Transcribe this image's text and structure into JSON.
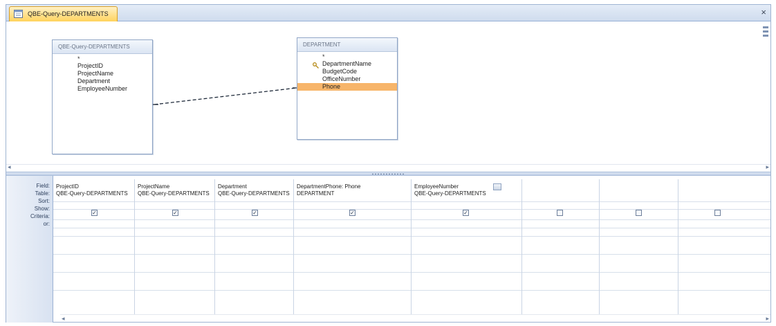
{
  "window": {
    "tab_title": "QBE-Query-DEPARTMENTS"
  },
  "tables": {
    "left": {
      "title": "QBE-Query-DEPARTMENTS",
      "star": "*",
      "fields": [
        "ProjectID",
        "ProjectName",
        "Department",
        "EmployeeNumber"
      ]
    },
    "right": {
      "title": "DEPARTMENT",
      "star": "*",
      "fields": [
        "DepartmentName",
        "BudgetCode",
        "OfficeNumber",
        "Phone"
      ],
      "selected_field": "Phone"
    }
  },
  "grid": {
    "row_labels": [
      "Field:",
      "Table:",
      "Sort:",
      "Show:",
      "Criteria:",
      "or:"
    ],
    "columns": [
      {
        "field": "ProjectID",
        "table": "QBE-Query-DEPARTMENTS",
        "show": true
      },
      {
        "field": "ProjectName",
        "table": "QBE-Query-DEPARTMENTS",
        "show": true
      },
      {
        "field": "Department",
        "table": "QBE-Query-DEPARTMENTS",
        "show": true
      },
      {
        "field": "DepartmentPhone: Phone",
        "table": "DEPARTMENT",
        "show": true
      },
      {
        "field": "EmployeeNumber",
        "table": "QBE-Query-DEPARTMENTS",
        "show": true
      },
      {
        "field": "",
        "table": "",
        "show": false
      },
      {
        "field": "",
        "table": "",
        "show": false
      },
      {
        "field": "",
        "table": "",
        "show": false
      }
    ]
  },
  "icons": {
    "close": "close-icon",
    "primary_key": "key-icon",
    "query": "query-icon"
  },
  "colors": {
    "accent_tab": "#ffd35e",
    "selected_field": "#f7b56a"
  }
}
